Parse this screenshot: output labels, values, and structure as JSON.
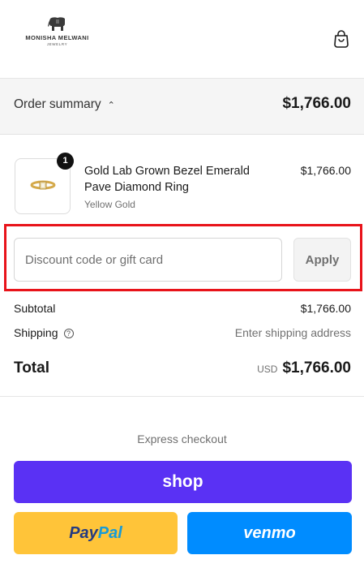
{
  "header": {
    "brand": "MONISHA MELWANI",
    "brand_sub": "JEWELRY",
    "logo_icon": "elephant-logo-icon",
    "cart_icon": "shopping-bag-icon"
  },
  "summary": {
    "toggle_label": "Order summary",
    "toggle_icon": "chevron-up-icon",
    "total": "$1,766.00"
  },
  "product": {
    "quantity": "1",
    "name": "Gold Lab Grown Bezel Emerald Pave Diamond Ring",
    "variant": "Yellow Gold",
    "price": "$1,766.00"
  },
  "discount": {
    "placeholder": "Discount code or gift card",
    "apply_label": "Apply"
  },
  "costs": {
    "subtotal_label": "Subtotal",
    "subtotal_value": "$1,766.00",
    "shipping_label": "Shipping",
    "shipping_help_icon": "question-circle-icon",
    "shipping_value": "Enter shipping address",
    "total_label": "Total",
    "currency": "USD",
    "total_value": "$1,766.00"
  },
  "express": {
    "label": "Express checkout",
    "shop_label": "shop",
    "paypal_pay": "Pay",
    "paypal_pal": "Pal",
    "venmo_label": "venmo"
  },
  "colors": {
    "shop": "#5a31f4",
    "paypal": "#ffc439",
    "venmo": "#008cff",
    "highlight": "#e8131a"
  }
}
